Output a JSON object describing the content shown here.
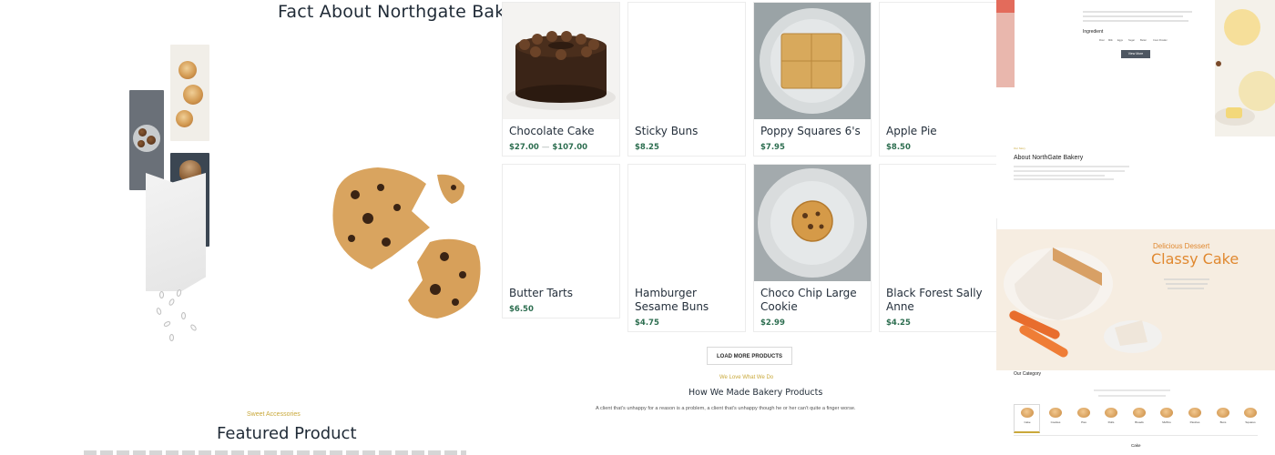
{
  "about_section": {
    "title": "Fact About Northgate Bakery"
  },
  "products": [
    {
      "name": "Chocolate Cake",
      "price": "$27.00",
      "price_max": "$107.00",
      "has_image": true,
      "image": "chocolate-cake"
    },
    {
      "name": "Sticky Buns",
      "price": "$8.25",
      "has_image": false
    },
    {
      "name": "Poppy Squares 6's",
      "price": "$7.95",
      "has_image": true,
      "image": "poppy-squares"
    },
    {
      "name": "Apple Pie",
      "price": "$8.50",
      "has_image": false
    },
    {
      "name": "Butter Tarts",
      "price": "$6.50",
      "has_image": false
    },
    {
      "name": "Hamburger Sesame Buns",
      "price": "$4.75",
      "has_image": false
    },
    {
      "name": "Choco Chip Large Cookie",
      "price": "$2.99",
      "has_image": true,
      "image": "choco-chip-cookie"
    },
    {
      "name": "Black Forest Sally Anne",
      "price": "$4.25",
      "has_image": false
    }
  ],
  "price_range_separator": "—",
  "load_more_label": "LOAD MORE PRODUCTS",
  "made_section": {
    "tagline": "We Love What We Do",
    "title": "How We Made Bakery Products",
    "subtitle": "A client that's unhappy for a reason is a problem, a client that's unhappy though he or her can't quite a finger worse."
  },
  "featured_section": {
    "tagline": "Sweet Accessories",
    "title": "Featured Product"
  },
  "preview_top": {
    "ingredient_label": "Ingredient",
    "ingredients": [
      "Flour",
      "Milk",
      "Eggs",
      "Sugar",
      "Butter",
      "Coco Powder"
    ],
    "view_more_label": "View More",
    "about_title": "About NorthGate Bakery",
    "about_tag": "Our Story"
  },
  "preview_bottom": {
    "hero_tag": "Delicious Dessert",
    "hero_title": "Classy Cake",
    "category_heading": "Our Category",
    "categories": [
      "Cake",
      "Cookies",
      "Pies",
      "Rolls",
      "Breads",
      "Muffins",
      "Pastries",
      "Buns",
      "Squares"
    ],
    "selected_category": "Cake",
    "section_label": "Cake"
  },
  "colors": {
    "accent_gold": "#c9a83a",
    "price_green": "#2d6e50",
    "title_dark": "#1f2a36",
    "hero_orange": "#e0882f"
  }
}
